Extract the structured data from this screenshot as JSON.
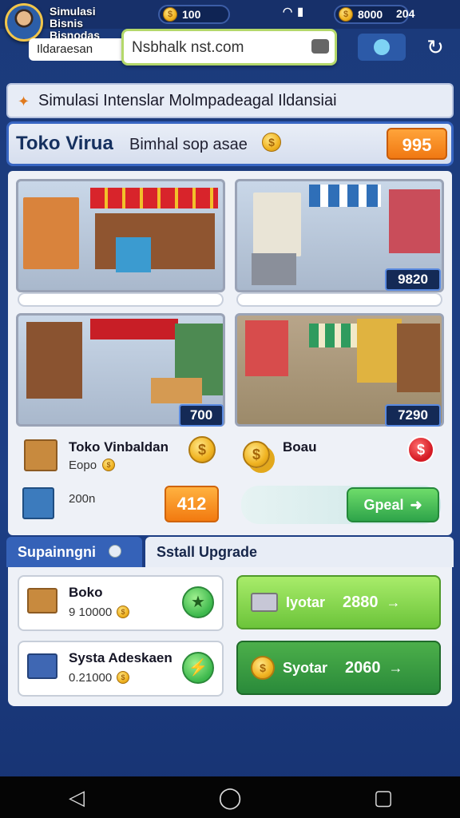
{
  "status_bar": {
    "app_title": "Simulasi Bisnis Bisnodas",
    "coins": "100",
    "gems": "8000",
    "signal": "204"
  },
  "header": {
    "tab_label": "Ildaraesan",
    "url": "Nsbhalk nst.com"
  },
  "banner": {
    "text": "Simulasi Intenslar Molmpadeagal Ildansiai"
  },
  "shop": {
    "title": "Toko Virua",
    "subtitle": "Bimhal sop asae",
    "balance": "995"
  },
  "stores": [
    {
      "name": "market-stall",
      "price": ""
    },
    {
      "name": "grocery-shop",
      "price": "9820"
    },
    {
      "name": "general-store",
      "price": "700"
    },
    {
      "name": "bazaar",
      "price": "7290"
    }
  ],
  "items": {
    "left_name": "Toko Vinbaldan",
    "left_sub": "Eopo",
    "right_name": "Boau",
    "left_value": "200n",
    "orange_value": "412",
    "green_label": "Gpeal"
  },
  "tabs": {
    "active": "Supainngni",
    "inactive": "Sstall Upgrade"
  },
  "upgrades": [
    {
      "name": "Boko",
      "sub": "9 10000",
      "buy_label": "Iyotar",
      "buy_amount": "2880"
    },
    {
      "name": "Systa Adeskaen",
      "sub": "0.21000",
      "buy_label": "Syotar",
      "buy_amount": "2060"
    }
  ],
  "colors": {
    "background": "#1d3f86",
    "accent_orange": "#f27a10",
    "accent_green": "#2ea44a",
    "coin_gold": "#f0b321"
  }
}
